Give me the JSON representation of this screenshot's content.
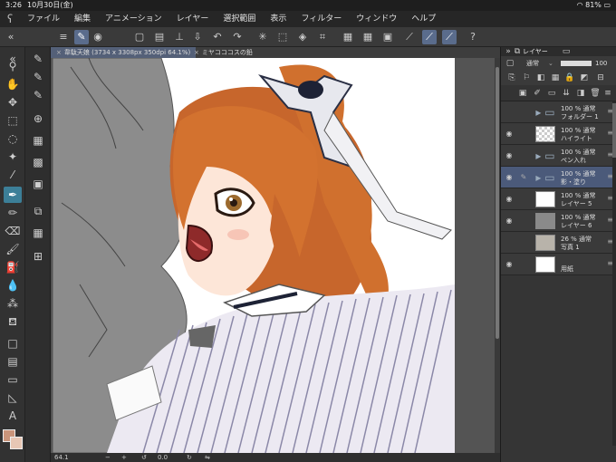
{
  "status": {
    "time": "3:26",
    "date": "10月30日(金)",
    "battery": "81%"
  },
  "menu": [
    "ファイル",
    "編集",
    "アニメーション",
    "レイヤー",
    "選択範囲",
    "表示",
    "フィルター",
    "ウィンドウ",
    "ヘルプ"
  ],
  "canvas": {
    "tabs": [
      {
        "label": "韋駄天娘 (3734 x 3308px 350dpi 64.1%)",
        "active": true
      },
      {
        "label": "ミヤコココスの鉛",
        "active": false
      }
    ],
    "zoom": "64.1",
    "angle": "0.0"
  },
  "layers_panel": {
    "tab_label": "レイヤー",
    "blend_mode": "通常",
    "opacity": "100",
    "layers": [
      {
        "line1": "100 % 通常",
        "line2": "フォルダー 1",
        "type": "folder",
        "visible": false,
        "selected": false
      },
      {
        "line1": "100 % 通常",
        "line2": "ハイライト",
        "type": "checker",
        "visible": true,
        "selected": false
      },
      {
        "line1": "100 % 通常",
        "line2": "ペン入れ",
        "type": "folder",
        "visible": true,
        "selected": false
      },
      {
        "line1": "100 % 通常",
        "line2": "影・塗り",
        "type": "folder",
        "visible": true,
        "selected": true
      },
      {
        "line1": "100 % 通常",
        "line2": "レイヤー 5",
        "type": "white",
        "visible": true,
        "selected": false
      },
      {
        "line1": "100 % 通常",
        "line2": "レイヤー 6",
        "type": "gray",
        "visible": true,
        "selected": false
      },
      {
        "line1": "26 % 通常",
        "line2": "写真 1",
        "type": "sketch",
        "visible": false,
        "selected": false
      },
      {
        "line1": "",
        "line2": "用紙",
        "type": "white",
        "visible": true,
        "selected": false
      }
    ]
  },
  "colors": {
    "main": "#c9947a",
    "sub": "#e7c7b5",
    "accent": "#3c7f98"
  }
}
